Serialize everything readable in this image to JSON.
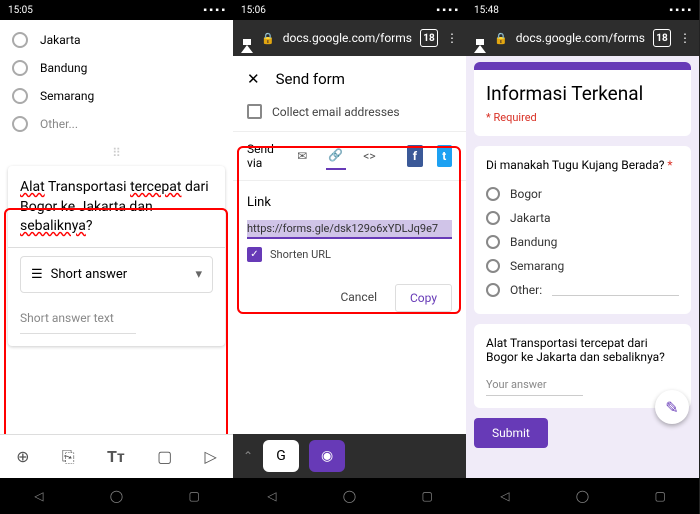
{
  "panel1": {
    "status_time": "15:05",
    "options": [
      "Jakarta",
      "Bandung",
      "Semarang",
      "Other..."
    ],
    "question_parts": {
      "p1": "Alat",
      "p2": "Transportasi",
      "p3": "tercepat",
      "p4": "dari Bogor ke Jakarta dan",
      "p5": "sebaliknya",
      "p6": "?"
    },
    "type_label": "Short answer",
    "placeholder": "Short answer text"
  },
  "panel2": {
    "status_time": "15:06",
    "url": "docs.google.com/forms",
    "tab_count": "18",
    "title": "Send form",
    "collect_label": "Collect email addresses",
    "send_via_label": "Send via",
    "link_label": "Link",
    "link_value": "https://forms.gle/dsk129o6xYDLJq9e7",
    "shorten_label": "Shorten URL",
    "cancel": "Cancel",
    "copy": "Copy"
  },
  "panel3": {
    "status_time": "15:48",
    "url": "docs.google.com/forms",
    "tab_count": "18",
    "form_title": "Informasi Terkenal",
    "required_label": "* Required",
    "q1_text": "Di manakah Tugu Kujang Berada?",
    "q1_options": [
      "Bogor",
      "Jakarta",
      "Bandung",
      "Semarang"
    ],
    "q1_other": "Other:",
    "q2_text": "Alat Transportasi tercepat dari Bogor ke Jakarta dan sebaliknya?",
    "q2_placeholder": "Your answer",
    "submit": "Submit"
  }
}
